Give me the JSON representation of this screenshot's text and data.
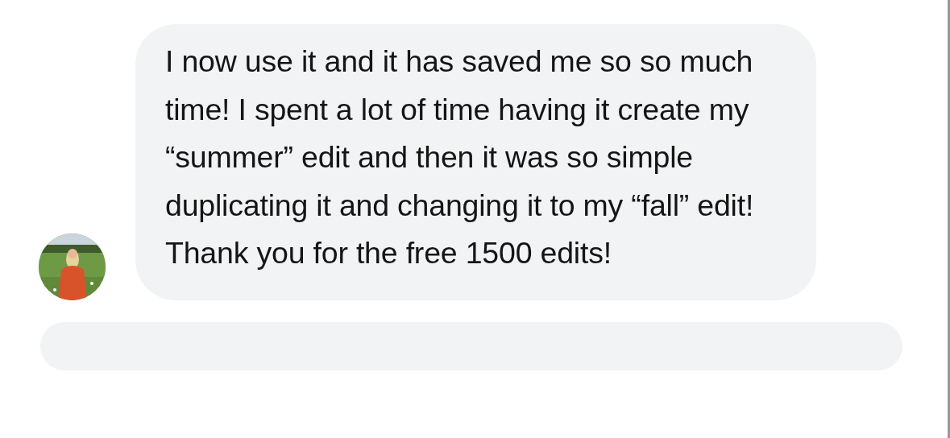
{
  "messages": [
    {
      "text": "I now use it and it has saved me so so much time! I spent a lot of time having it create my “summer” edit and then it was so simple duplicating it and changing it to my “fall” edit! Thank you for the free 1500 edits!"
    }
  ]
}
